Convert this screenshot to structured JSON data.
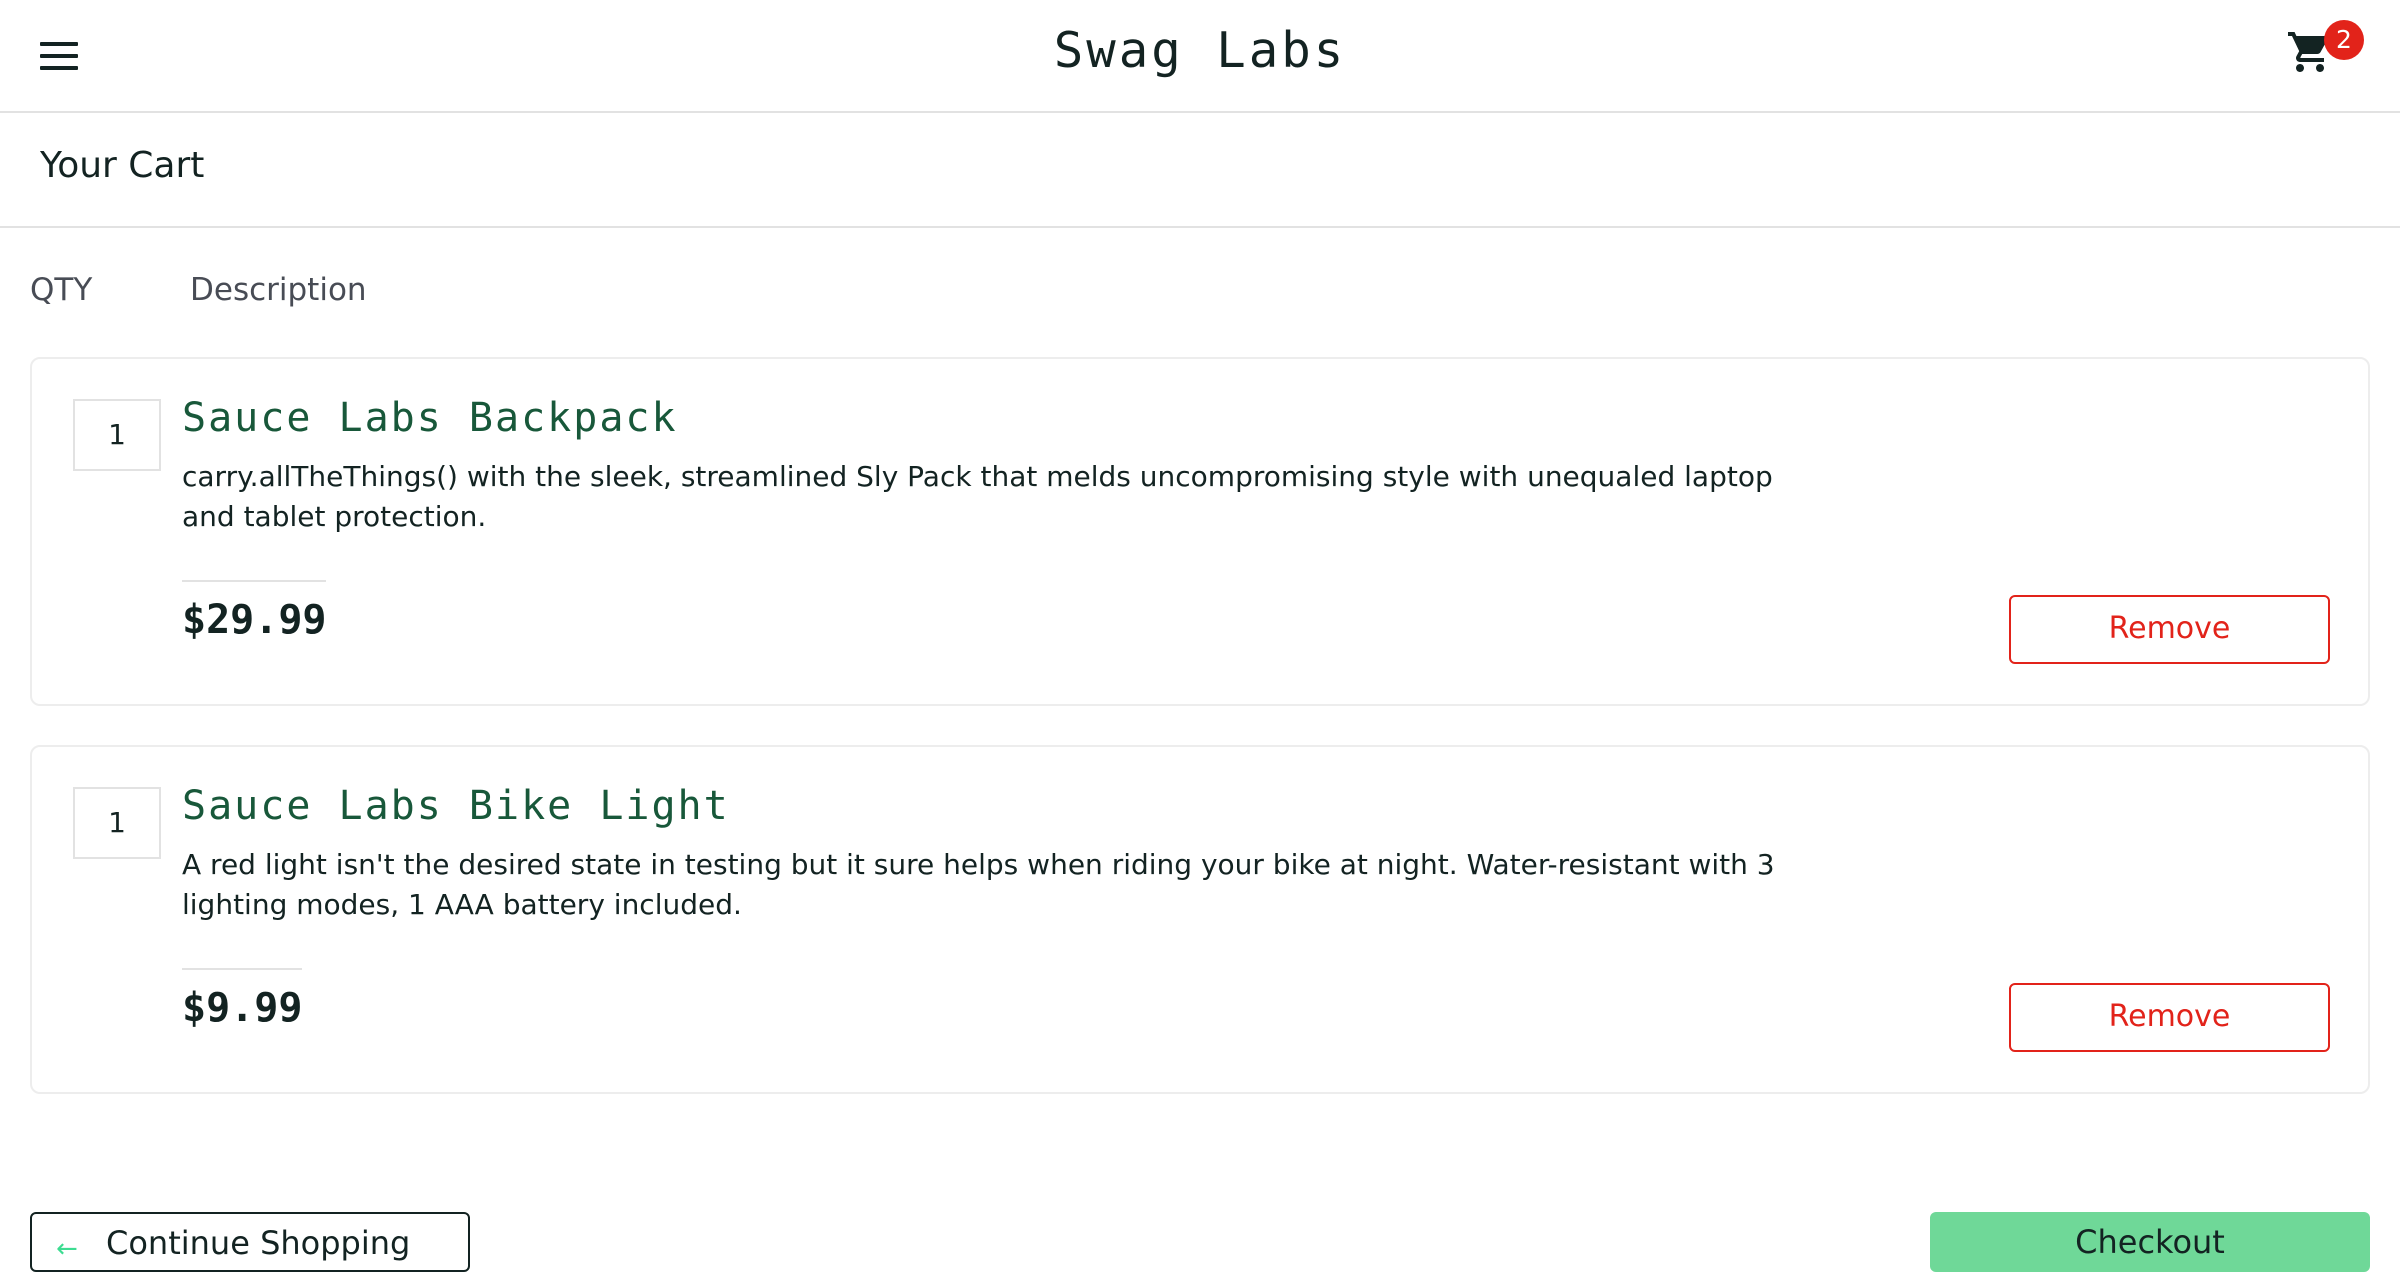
{
  "header": {
    "logo": "Swag Labs",
    "cart_badge": "2",
    "menu_icon": "hamburger-menu-icon",
    "cart_icon": "shopping-cart-icon"
  },
  "secondary": {
    "title": "Your Cart"
  },
  "cart_list": {
    "qty_label": "QTY",
    "desc_label": "Description"
  },
  "items": [
    {
      "quantity": "1",
      "name": "Sauce Labs Backpack",
      "description": "carry.allTheThings() with the sleek, streamlined Sly Pack that melds uncompromising style with unequaled laptop and tablet protection.",
      "price": "$29.99",
      "remove_label": "Remove"
    },
    {
      "quantity": "1",
      "name": "Sauce Labs Bike Light",
      "description": "A red light isn't the desired state in testing but it sure helps when riding your bike at night. Water-resistant with 3 lighting modes, 1 AAA battery included.",
      "price": "$9.99",
      "remove_label": "Remove"
    }
  ],
  "footer": {
    "continue_label": "Continue Shopping",
    "checkout_label": "Checkout",
    "back_icon": "arrow-left-icon"
  },
  "colors": {
    "item_name": "#18583a",
    "remove": "#e2231a",
    "badge": "#e2231a",
    "checkout": "#6fd898"
  }
}
